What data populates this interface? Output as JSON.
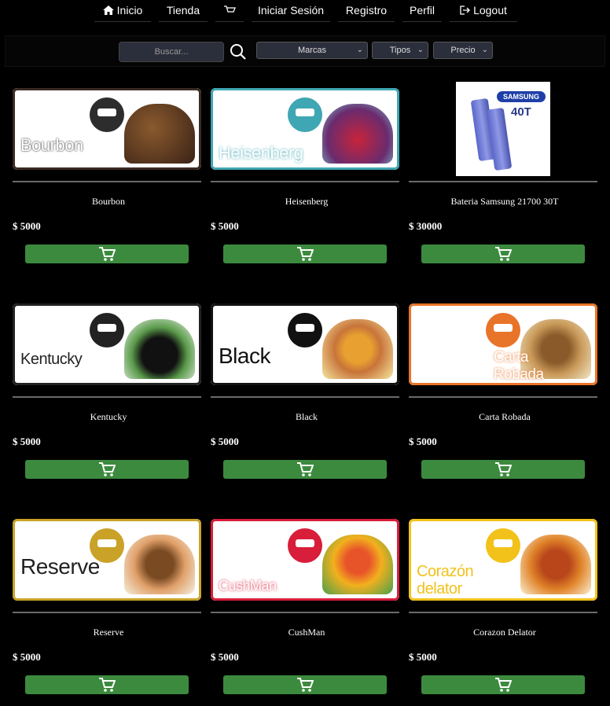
{
  "nav": {
    "items": [
      {
        "label": "Inicio",
        "icon": "home-icon"
      },
      {
        "label": "Tienda"
      },
      {
        "label": "",
        "icon": "cart-icon"
      },
      {
        "label": "Iniciar Sesión"
      },
      {
        "label": "Registro"
      },
      {
        "label": "Perfil"
      },
      {
        "label": "Logout",
        "icon": "logout-icon"
      }
    ]
  },
  "filters": {
    "search_placeholder": "Buscar...",
    "marcas": "Marcas",
    "tipos": "Tipos",
    "precio": "Precio"
  },
  "colors": {
    "cart_button": "#3c8a3e",
    "background": "#000000"
  },
  "products": [
    {
      "name": "Bourbon",
      "price": "$ 5000",
      "banner_text": "Bourbon",
      "banner_color": "#3a2a22"
    },
    {
      "name": "Heisenberg",
      "price": "$ 5000",
      "banner_text": "Heisenberg",
      "banner_color": "#3fa7b3"
    },
    {
      "name": "Bateria Samsung 21700 30T",
      "price": "$ 30000",
      "image_text_1": "SAMSUNG",
      "image_text_2": "40T"
    },
    {
      "name": "Kentucky",
      "price": "$ 5000",
      "banner_text": "Kentucky",
      "banner_color": "#222222"
    },
    {
      "name": "Black",
      "price": "$ 5000",
      "banner_text": "Black",
      "banner_color": "#111111"
    },
    {
      "name": "Carta Robada",
      "price": "$ 5000",
      "banner_text": "Carta Robada",
      "banner_color": "#e8742a"
    },
    {
      "name": "Reserve",
      "price": "$ 5000",
      "banner_text": "Reserve",
      "banner_color": "#c9a227"
    },
    {
      "name": "CushMan",
      "price": "$ 5000",
      "banner_text": "CushMan",
      "banner_color": "#d81e3a"
    },
    {
      "name": "Corazon Delator",
      "price": "$ 5000",
      "banner_text": "Corazón delator",
      "banner_color": "#f2c21b"
    }
  ]
}
